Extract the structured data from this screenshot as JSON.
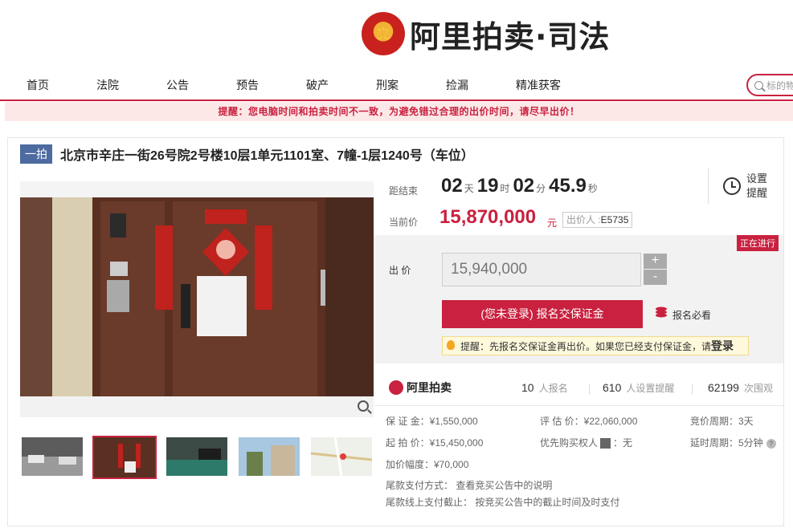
{
  "brand": {
    "title": "阿里拍卖·司法",
    "emblem_icon": "court-emblem-icon"
  },
  "nav": {
    "items": [
      "首页",
      "法院",
      "公告",
      "预告",
      "破产",
      "刑案",
      "捡漏",
      "精准获客"
    ],
    "search_placeholder": "标的物"
  },
  "notice": "提醒：您电脑时间和拍卖时间不一致，为避免错过合理的出价时间，请尽早出价！",
  "item": {
    "round_badge": "一拍",
    "title": "北京市辛庄一街26号院2号楼10层1单元1101室、7幢-1层1240号（车位）"
  },
  "countdown": {
    "label": "距结束",
    "days": "02",
    "days_unit": "天",
    "hours": "19",
    "hours_unit": "时",
    "minutes": "02",
    "minutes_unit": "分",
    "seconds": "45.9",
    "seconds_unit": "秒"
  },
  "reminder": {
    "line1": "设置",
    "line2": "提醒"
  },
  "current_price": {
    "label": "当前价",
    "value": "15,870,000",
    "unit": "元",
    "bidder_label": "出价人 :",
    "bidder_id": "E5735"
  },
  "status_badge": "正在进行",
  "bid": {
    "label": "出 价",
    "value": "15,940,000",
    "plus": "+",
    "minus": "-",
    "enroll_button": "(您未登录) 报名交保证金",
    "must_read": "报名必看",
    "tip_text": "提醒：先报名交保证金再出价。如果您已经支付保证金，请",
    "tip_link": "登录"
  },
  "stats": {
    "logo_text": "阿里拍卖",
    "registered": "10",
    "registered_label": "人报名",
    "reminders": "610",
    "reminders_label": "人设置提醒",
    "views": "62199",
    "views_label": "次围观"
  },
  "details": {
    "deposit": "保 证 金：¥1,550,000",
    "appraisal": "评 估 价：¥22,060,000",
    "period": "竞价周期：3天",
    "start_price": "起 拍 价：¥15,450,000",
    "priority": "优先购买权人",
    "priority_badge": "有",
    "priority_value": "：无",
    "delay": "延时周期：5分钟",
    "increment": "加价幅度：¥70,000",
    "payment_method": "尾款支付方式： 查看竞买公告中的说明",
    "payment_deadline": "尾款线上支付截止： 按竞买公告中的截止时间及时支付"
  }
}
